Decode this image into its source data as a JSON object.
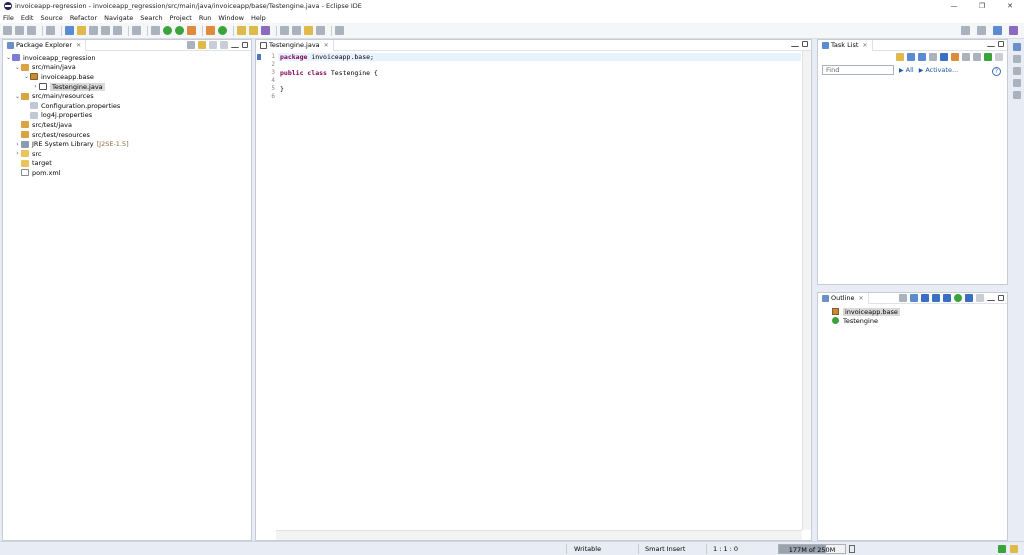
{
  "window": {
    "title": "invoiceapp-regression - invoiceapp_regression/src/main/java/invoiceapp/base/Testengine.java - Eclipse IDE",
    "minimize": "—",
    "maximize": "❐",
    "close": "✕"
  },
  "menu": [
    "File",
    "Edit",
    "Source",
    "Refactor",
    "Navigate",
    "Search",
    "Project",
    "Run",
    "Window",
    "Help"
  ],
  "package_explorer": {
    "tab_label": "Package Explorer",
    "nodes": [
      {
        "label": "invoiceapp_regression",
        "twisty": "⌄",
        "icon": "project",
        "decor": ""
      },
      {
        "label": "src/main/java",
        "twisty": "⌄",
        "icon": "srcfolder",
        "decor": ""
      },
      {
        "label": "invoiceapp.base",
        "twisty": "⌄",
        "icon": "package",
        "decor": ""
      },
      {
        "label": "Testengine.java",
        "twisty": "›",
        "icon": "java",
        "decor": "",
        "selected": true
      },
      {
        "label": "src/main/resources",
        "twisty": "⌄",
        "icon": "srcfolder",
        "decor": ""
      },
      {
        "label": "Configuration.properties",
        "twisty": "",
        "icon": "props",
        "decor": ""
      },
      {
        "label": "log4j.properties",
        "twisty": "",
        "icon": "props",
        "decor": ""
      },
      {
        "label": "src/test/java",
        "twisty": "",
        "icon": "srcfolder",
        "decor": ""
      },
      {
        "label": "src/test/resources",
        "twisty": "",
        "icon": "srcfolder",
        "decor": ""
      },
      {
        "label": "JRE System Library",
        "twisty": "›",
        "icon": "lib",
        "decor": "[J2SE-1.5]"
      },
      {
        "label": "src",
        "twisty": "›",
        "icon": "folder",
        "decor": ""
      },
      {
        "label": "target",
        "twisty": "",
        "icon": "folder",
        "decor": ""
      },
      {
        "label": "pom.xml",
        "twisty": "",
        "icon": "xml",
        "decor": ""
      }
    ]
  },
  "editor": {
    "tab_label": "Testengine.java",
    "line_numbers": [
      "1",
      "2",
      "3",
      "4",
      "5",
      "6"
    ],
    "lines": [
      {
        "kw": "package",
        "rest": " invoiceapp.base;"
      },
      {
        "kw": "",
        "rest": ""
      },
      {
        "kw": "public class",
        "rest": " Testengine {"
      },
      {
        "kw": "",
        "rest": ""
      },
      {
        "kw": "",
        "rest": "}"
      },
      {
        "kw": "",
        "rest": ""
      }
    ]
  },
  "task_list": {
    "tab_label": "Task List",
    "find_placeholder": "Find",
    "all_label": "All",
    "activate_label": "Activate..."
  },
  "outline": {
    "tab_label": "Outline",
    "items": [
      {
        "label": "invoiceapp.base",
        "icon": "pkg",
        "selected": true
      },
      {
        "label": "Testengine",
        "icon": "cls",
        "selected": false
      }
    ]
  },
  "status": {
    "writable": "Writable",
    "insert_mode": "Smart Insert",
    "position": "1 : 1 : 0",
    "heap": "177M of 250M",
    "heap_fraction": 0.708
  },
  "colors": {
    "keyword": "#7f0055",
    "link": "#1a5aa6",
    "selection": "#d9d9d9"
  }
}
